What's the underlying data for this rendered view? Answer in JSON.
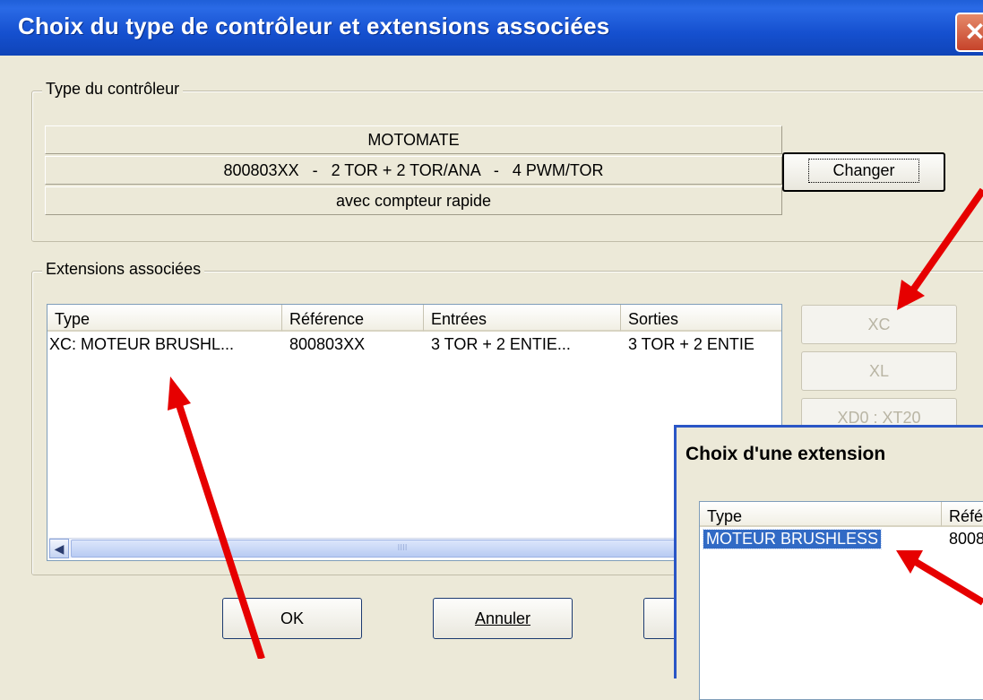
{
  "window": {
    "title": "Choix du type de contrôleur et extensions associées",
    "close_glyph": "✕"
  },
  "controller_group": {
    "label": "Type du contrôleur",
    "name": "MOTOMATE",
    "spec": "800803XX   -   2 TOR + 2 TOR/ANA   -   4 PWM/TOR",
    "option": "avec compteur rapide",
    "change_button": "Changer"
  },
  "extensions_group": {
    "label": "Extensions associées",
    "columns": [
      "Type",
      "Référence",
      "Entrées",
      "Sorties"
    ],
    "rows": [
      {
        "type": "XC: MOTEUR BRUSHL...",
        "reference": "800803XX",
        "inputs": "3 TOR + 2 ENTIE...",
        "outputs": "3 TOR + 2 ENTIE"
      }
    ],
    "side_buttons": [
      "XC",
      "XL",
      "XD0 : XT20"
    ],
    "scroll_grip": "IIII"
  },
  "footer": {
    "ok_button": "OK",
    "cancel_button": "Annuler"
  },
  "sub_dialog": {
    "title": "Choix d'une extension",
    "columns": [
      "Type",
      "Réfé"
    ],
    "rows": [
      {
        "type": "MOTEUR BRUSHLESS",
        "reference": "8008"
      }
    ]
  },
  "colors": {
    "title_bar": "#1550cf",
    "dialog_bg": "#ece9d8",
    "selection": "#316ac5",
    "annotation_arrow": "#e60000"
  }
}
